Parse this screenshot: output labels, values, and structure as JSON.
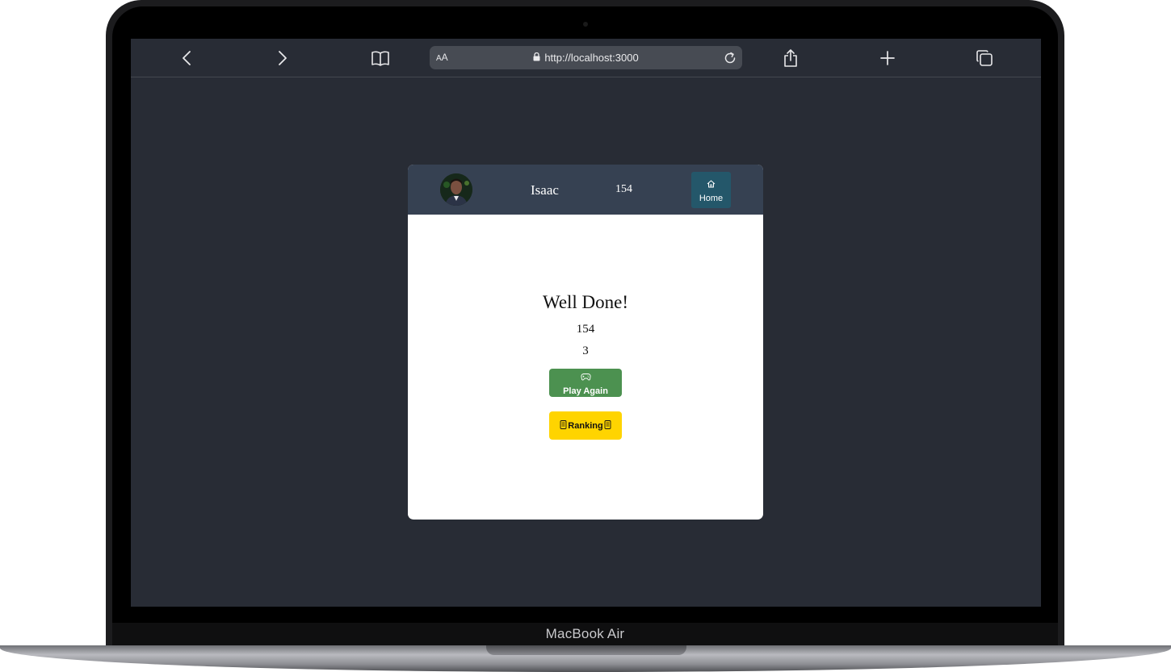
{
  "device": {
    "label": "MacBook Air"
  },
  "browser": {
    "url": "http://localhost:3000",
    "reader_label_small": "A",
    "reader_label": "A",
    "icons": [
      "back-icon",
      "forward-icon",
      "bookmarks-icon",
      "lock-icon",
      "reload-icon",
      "share-icon",
      "new-tab-icon",
      "tabs-icon"
    ]
  },
  "app": {
    "header": {
      "username": "Isaac",
      "score": "154",
      "home_label": "Home"
    },
    "result": {
      "title": "Well Done!",
      "score": "154",
      "count": "3"
    },
    "buttons": {
      "play_again": "Play Again",
      "ranking": "Ranking"
    },
    "colors": {
      "page_bg": "#282c35",
      "header_bg": "#364152",
      "home_button": "#24576a",
      "play_button": "#4c9150",
      "ranking_button": "#ffd400"
    }
  }
}
